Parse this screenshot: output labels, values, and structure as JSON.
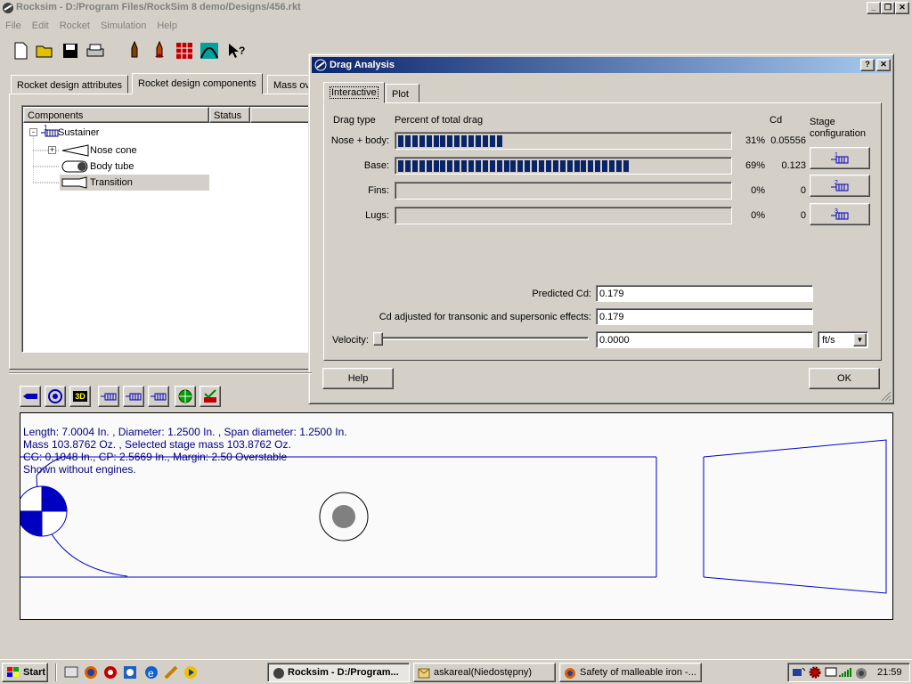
{
  "app": {
    "title": "Rocksim - D:/Program Files/RockSim 8 demo/Designs/456.rkt"
  },
  "menu": [
    "File",
    "Edit",
    "Rocket",
    "Simulation",
    "Help"
  ],
  "tabs": [
    "Rocket design attributes",
    "Rocket design components",
    "Mass ov"
  ],
  "tree": {
    "headers": [
      "Components",
      "Status"
    ],
    "items": [
      {
        "num": "1",
        "label": "Sustainer"
      },
      {
        "label": "Nose cone"
      },
      {
        "label": "Body tube"
      },
      {
        "label": "Transition"
      }
    ]
  },
  "dialog": {
    "title": "Drag Analysis",
    "tabs": [
      "Interactive",
      "Plot"
    ],
    "headers": {
      "type": "Drag type",
      "percent": "Percent of total drag",
      "cd": "Cd",
      "stage": "Stage configuration"
    },
    "rows": [
      {
        "label": "Nose + body:",
        "pct": "31%",
        "cd": "0.05556",
        "fill": 0.31
      },
      {
        "label": "Base:",
        "pct": "69%",
        "cd": "0.123",
        "fill": 0.69
      },
      {
        "label": "Fins:",
        "pct": "0%",
        "cd": "0",
        "fill": 0
      },
      {
        "label": "Lugs:",
        "pct": "0%",
        "cd": "0",
        "fill": 0
      }
    ],
    "stage_buttons": [
      "1",
      "2",
      "3"
    ],
    "predicted_label": "Predicted Cd:",
    "predicted_value": "0.179",
    "adjusted_label": "Cd adjusted for transonic and supersonic effects:",
    "adjusted_value": "0.179",
    "velocity_label": "Velocity:",
    "velocity_value": "0.0000",
    "velocity_unit": "ft/s",
    "help": "Help",
    "ok": "OK"
  },
  "bottom_tools": [
    "3D"
  ],
  "info": [
    "Length: 7.0004 In. , Diameter: 1.2500 In. , Span diameter: 1.2500 In.",
    "Mass 103.8762 Oz. , Selected stage mass 103.8762 Oz.",
    "CG: 0.1048 In., CP: 2.5669 In., Margin: 2.50 Overstable",
    "Shown without engines."
  ],
  "taskbar": {
    "start": "Start",
    "tasks": [
      "Rocksim - D:/Program...",
      "askareal(Niedostępny)",
      "Safety of malleable iron -..."
    ],
    "clock": "21:59"
  },
  "colors": {
    "accent": "#0a246a",
    "drawing": "#0000c0"
  }
}
